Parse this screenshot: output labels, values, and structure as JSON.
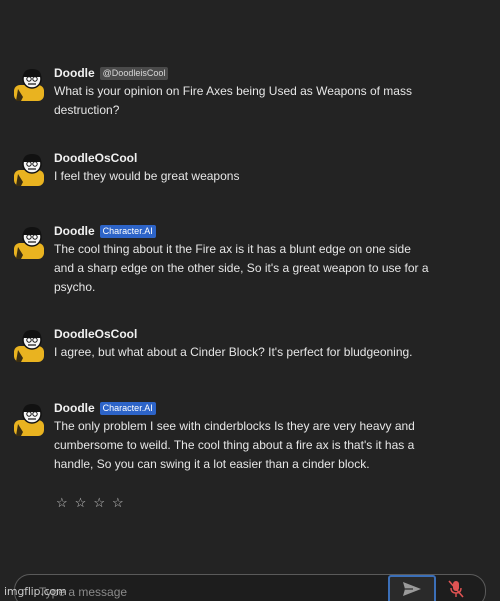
{
  "messages": [
    {
      "author": "Doodle",
      "badge": "@DoodleisCool",
      "badge_type": "user",
      "text": "What is your opinion on Fire Axes being Used as Weapons of mass destruction?"
    },
    {
      "author": "DoodleOsCool",
      "badge": "",
      "badge_type": "none",
      "text": "I feel they would be great weapons"
    },
    {
      "author": "Doodle",
      "badge": "Character.AI",
      "badge_type": "ai",
      "text": "The cool thing about it the Fire ax is it has a blunt edge on one side and a sharp edge on the other side, So it's a great weapon to use for a psycho."
    },
    {
      "author": "DoodleOsCool",
      "badge": "",
      "badge_type": "none",
      "text": "I agree, but what about a Cinder Block? It's perfect for bludgeoning."
    },
    {
      "author": "Doodle",
      "badge": "Character.AI",
      "badge_type": "ai",
      "text": "The only problem I see with cinderblocks Is they are very heavy and cumbersome to weild. The cool thing about a fire ax is that's it has a handle, So you can swing it a lot easier than a cinder block."
    }
  ],
  "rating": {
    "stars": [
      "☆",
      "☆",
      "☆",
      "☆"
    ]
  },
  "composer": {
    "placeholder": "Type a message",
    "send_icon": "send-icon",
    "mic_icon": "mic-off-icon"
  },
  "watermark": "imgflip.com",
  "colors": {
    "background": "#232323",
    "ai_badge": "#2d64c8",
    "user_badge": "#4a4a4a",
    "send_border": "#3b6fb8",
    "mic_off": "#e05353"
  }
}
